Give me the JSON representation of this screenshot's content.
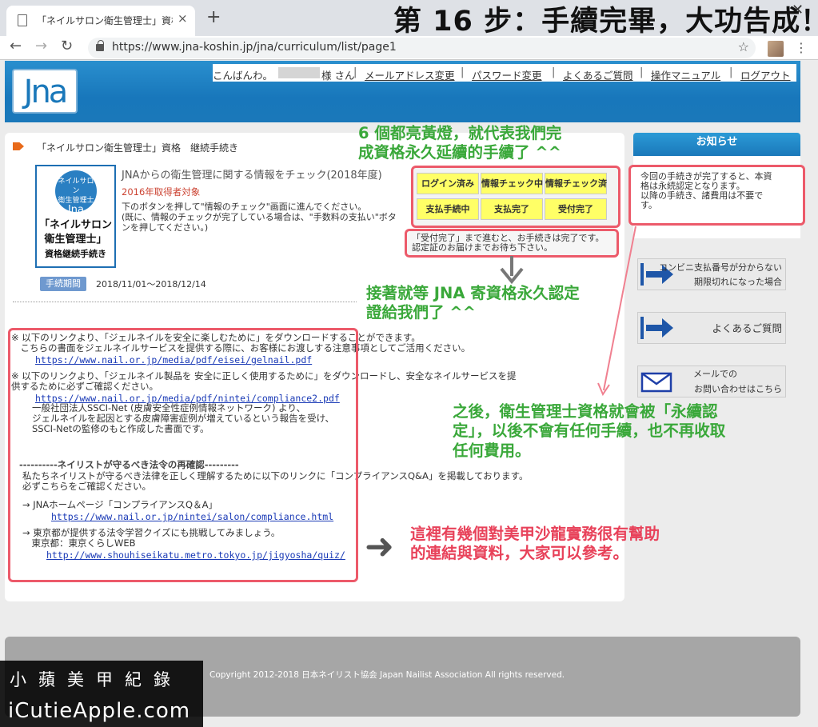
{
  "browser": {
    "tab_title": "「ネイルサロン衛生管理士」資格",
    "new_tab": "+",
    "url": "https://www.jna-koshin.jp/jna/curriculum/list/page1",
    "back": "←",
    "forward": "→",
    "reload": "↻",
    "star": "☆",
    "menu": "⋮",
    "close": "×",
    "window_close": "✕"
  },
  "banner": "第 16 步：手續完畢，大功告成！",
  "header": {
    "logo": "Jna",
    "greeting_prefix": "こんばんわ。",
    "greeting_suffix": "様 さん",
    "links": [
      "メールアドレス変更",
      "パスワード変更",
      "よくあるご質問",
      "操作マニュアル",
      "ログアウト"
    ],
    "separator": "|"
  },
  "course": {
    "title": "「ネイルサロン衛生管理士」資格　継続手続き",
    "badge_circle": [
      "ネイルサロン",
      "衛生管理士",
      "Jna"
    ],
    "badge_lines": [
      "「ネイルサロン",
      "衛生管理士」",
      "資格継続手続き"
    ],
    "check_heading": "JNAからの衛生管理に関する情報をチェック(2018年度)",
    "check_target": "2016年取得者対象",
    "check_desc": [
      "下のボタンを押して\"情報のチェック\"画面に進んでください。",
      "(既に、情報のチェックが完了している場合は、\"手数料の支払い\"ボタ",
      "ンを押してください。)"
    ],
    "status_cells": [
      [
        "ログイン済み",
        "情報チェック中",
        "情報チェック済"
      ],
      [
        "支払手続中",
        "支払完了",
        "受付完了"
      ]
    ],
    "status_note": [
      "「受付完了」まで進むと、お手続きは完了です。",
      "認定証のお届けまでお待ち下さい。"
    ],
    "period_label": "手続期間",
    "period_value": "2018/11/01〜2018/12/14"
  },
  "links_section": {
    "note1": [
      "※ 以下のリンクより、「ジェルネイルを安全に楽しむために」をダウンロードすることができます。",
      "　こちらの書面をジェルネイルサービスを提供する際に、お客様にお渡しする注意事項としてご活用ください。"
    ],
    "link1": "https://www.nail.or.jp/media/pdf/eisei/gelnail.pdf",
    "note2": [
      "※ 以下のリンクより、「ジェルネイル製品を 安全に正しく使用するために」をダウンロードし、安全なネイルサービスを提",
      "供するために必ずご確認ください。"
    ],
    "link2": "https://www.nail.or.jp/media/pdf/nintei/compliance2.pdf",
    "note2b": [
      "一般社団法人SSCI-Net (皮膚安全性症例情報ネットワーク) より、",
      "ジェルネイルを起因とする皮膚障害症例が増えているという報告を受け、",
      "SSCI-Netの監修のもと作成した書面です。"
    ],
    "law_heading": "----------ネイリストが守るべき法令の再確認---------",
    "law_desc": [
      "私たちネイリストが守るべき法律を正しく理解するために以下のリンクに「コンプライアンスQ&A」を掲載しております。",
      "必ずこちらをご確認ください。"
    ],
    "compliance_label": "→ JNAホームページ「コンプライアンスQ＆A」",
    "link3": "https://www.nail.or.jp/nintei/salon/compliance.html",
    "quiz_label": [
      "→ 東京都が提供する法令学習クイズにも挑戦してみましょう。",
      "　東京都：東京くらしWEB"
    ],
    "link4": "http://www.shouhiseikatu.metro.tokyo.jp/jigyosha/quiz/"
  },
  "sidebar": {
    "notice_title": "お知らせ",
    "notice_body": [
      "今回の手続きが完了すると、本資",
      "格は永続認定となります。",
      "以降の手続き、諸費用は不要で",
      "す。"
    ],
    "btn_conveni": [
      "コンビニ支払番号が分からない",
      "期限切れになった場合"
    ],
    "btn_faq": "よくあるご質問",
    "btn_mail": [
      "メールでの",
      "お問い合わせはこちら"
    ]
  },
  "annotations": {
    "a1": [
      "6 個都亮黃燈，就代表我們完",
      "成資格永久延續的手續了 ^^"
    ],
    "a2": [
      "接著就等 JNA 寄資格永久認定",
      "證給我們了 ^^"
    ],
    "a3": [
      "之後，衛生管理士資格就會被「永續認",
      "定」，以後不會有任何手續，也不再收取",
      "任何費用。"
    ],
    "a4": [
      "這裡有幾個對美甲沙龍實務很有幫助",
      "的連結與資料，大家可以參考。"
    ],
    "arrow_right": "➜"
  },
  "footer": {
    "copyright": "Copyright 2012-2018 日本ネイリスト協会 Japan Nailist Association All rights reserved."
  },
  "watermark": {
    "cn": "小蘋美甲紀錄",
    "en": "iCutieApple.com"
  },
  "colors": {
    "header_blue": "#1a78ba",
    "highlight_red": "#ec5a6a",
    "status_yellow": "#ffff66",
    "anno_green": "#3aa83a",
    "anno_red": "#e8425a"
  }
}
